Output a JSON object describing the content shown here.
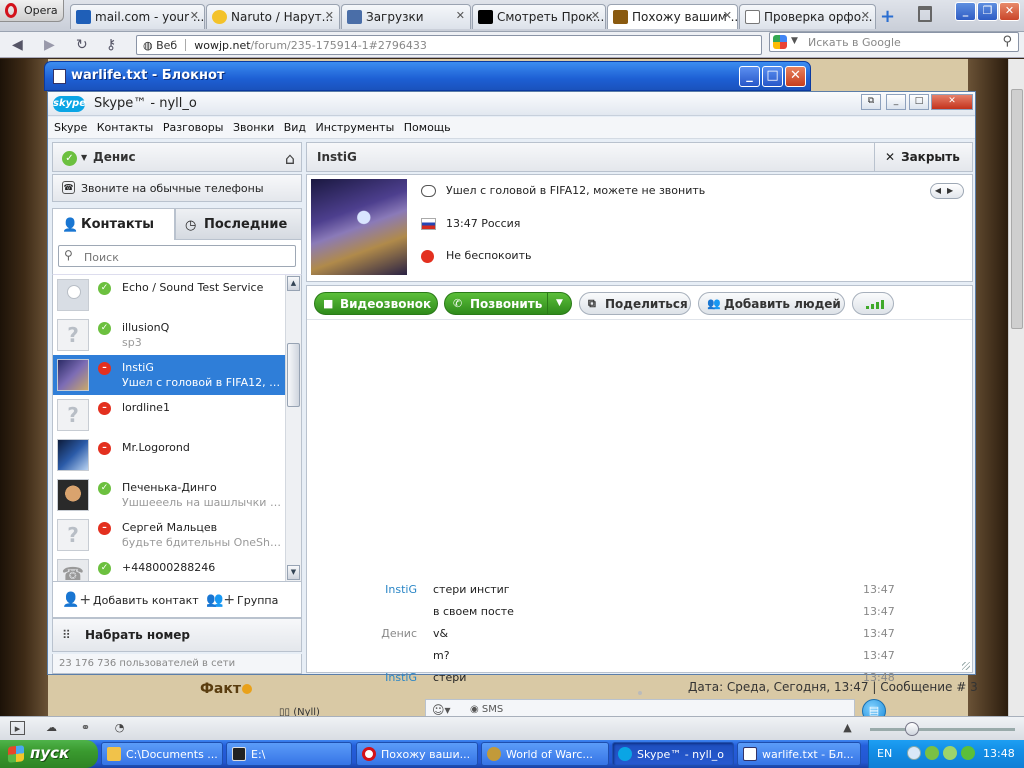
{
  "opera": {
    "menu_label": "Opera",
    "tabs": [
      {
        "label": "mail.com - your ..."
      },
      {
        "label": "Naruto / Нарут..."
      },
      {
        "label": "Загрузки"
      },
      {
        "label": "Смотреть Прок..."
      },
      {
        "label": "Похожу вашим ..."
      },
      {
        "label": "Проверка орфо..."
      }
    ],
    "address": {
      "scheme_label": "Веб",
      "host": "wowjp.net",
      "path": "/forum/235-175914-1#2796433"
    },
    "search_placeholder": "Искать в Google"
  },
  "notepad": {
    "title": "warlife.txt - Блокнот"
  },
  "skype": {
    "title": "Skype™ - nyll_o",
    "logo_text": "skype",
    "menu": [
      "Skype",
      "Контакты",
      "Разговоры",
      "Звонки",
      "Вид",
      "Инструменты",
      "Помощь"
    ],
    "user": {
      "name": "Денис"
    },
    "call_phones_label": "Звоните на обычные телефоны",
    "tabs": {
      "contacts": "Контакты",
      "recent": "Последние"
    },
    "search_placeholder": "Поиск",
    "contacts": [
      {
        "name": "Echo / Sound Test Service",
        "mood": "",
        "status": "online"
      },
      {
        "name": "illusionQ",
        "mood": "sp3",
        "status": "online"
      },
      {
        "name": "InstiG",
        "mood": "Ушел с головой в FIFA12, мо...",
        "status": "dnd"
      },
      {
        "name": "lordline1",
        "mood": "",
        "status": "dnd"
      },
      {
        "name": "Mr.Logorond",
        "mood": "",
        "status": "dnd"
      },
      {
        "name": "Печенька-Динго",
        "mood": "Ушшееель на шашлычки :D",
        "status": "online"
      },
      {
        "name": "Сергей Мальцев",
        "mood": "будьте бдительны OneShoo...",
        "status": "dnd"
      },
      {
        "name": "+448000288246",
        "mood": "",
        "status": "online"
      }
    ],
    "add_contact_label": "Добавить контакт",
    "group_label": "Группа",
    "dial_label": "Набрать номер",
    "online_count": "23 176 736 пользователей в сети",
    "chat": {
      "contact_name": "InstiG",
      "close_label": "Закрыть",
      "mood": "Ушел с головой в FIFA12, можете не звонить",
      "local_time": "13:47 Россия",
      "status_text": "Не беспокоить",
      "buttons": {
        "video": "Видеозвонок",
        "call": "Позвонить",
        "share": "Поделиться",
        "add_people": "Добавить людей"
      },
      "messages": [
        {
          "from": "InstiG",
          "text": "стери инстиг",
          "time": "13:47",
          "side": "them"
        },
        {
          "from": "",
          "text": "в своем посте",
          "time": "13:47",
          "side": "them"
        },
        {
          "from": "Денис",
          "text": "v&",
          "time": "13:47",
          "side": "me"
        },
        {
          "from": "",
          "text": "m?",
          "time": "13:47",
          "side": "me"
        },
        {
          "from": "InstiG",
          "text": "стери",
          "time": "13:48",
          "side": "them"
        }
      ],
      "sms_label": "SMS"
    }
  },
  "forum": {
    "section": "Факт",
    "post_date": "Дата: Среда, Сегодня, 13:47 | Сообщение #",
    "post_number": "3",
    "author": "(Nyll)"
  },
  "taskbar": {
    "start_label": "пуск",
    "items": [
      {
        "label": "C:\\Documents ..."
      },
      {
        "label": "E:\\"
      },
      {
        "label": "Похожу ваши..."
      },
      {
        "label": "World of Warc..."
      },
      {
        "label": "Skype™ - nyll_o"
      },
      {
        "label": "warlife.txt - Бл..."
      }
    ],
    "lang": "EN",
    "clock": "13:48"
  }
}
